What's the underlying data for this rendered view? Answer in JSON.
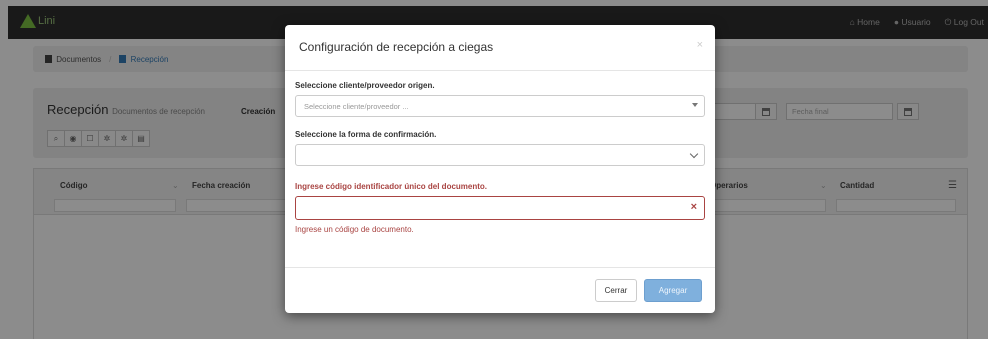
{
  "navbar": {
    "brand": "Lini",
    "links": [
      "Home",
      "Usuario",
      "Log Out"
    ]
  },
  "breadcrumb": {
    "items": [
      "Documentos",
      "Recepción"
    ]
  },
  "page": {
    "title": "Recepción",
    "subtitle": "Documentos de recepción",
    "creacion_label": "Creación",
    "date_from_placeholder": "",
    "date_to_placeholder": "Fecha final",
    "toolbar_icons": [
      "search-icon",
      "eye-icon",
      "edit-icon",
      "gear-icon",
      "settings-icon",
      "document-icon"
    ]
  },
  "grid": {
    "columns": [
      "Código",
      "Fecha creación",
      "Operarios",
      "Cantidad"
    ]
  },
  "modal": {
    "title": "Configuración de recepción a ciegas",
    "close_glyph": "×",
    "client_label": "Seleccione cliente/proveedor origen.",
    "client_placeholder": "Seleccione cliente/proveedor ...",
    "confirm_label": "Seleccione la forma de confirmación.",
    "confirm_value": "",
    "code_label": "Ingrese código identificador único del documento.",
    "code_value": "",
    "code_error": "Ingrese un código de documento.",
    "cancel_label": "Cerrar",
    "submit_label": "Agregar"
  },
  "colors": {
    "navbar": "#2f2f2f",
    "brand_green": "#7dc242",
    "error": "#a94442",
    "primary_disabled": "#7fb0dd",
    "link": "#337ab7"
  }
}
